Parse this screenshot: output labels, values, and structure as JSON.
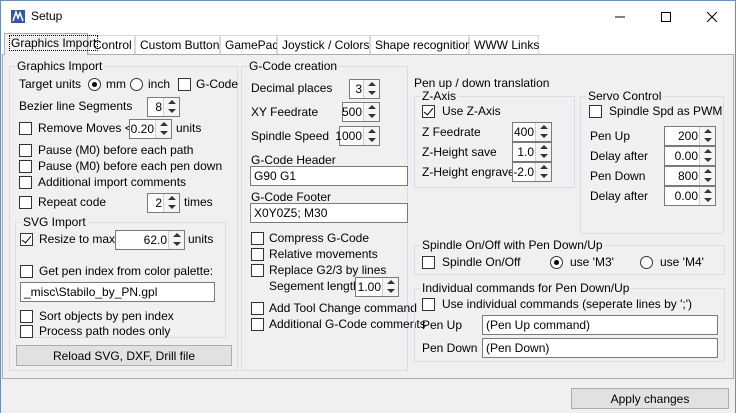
{
  "window": {
    "title": "Setup",
    "icon": "app-icon"
  },
  "tabs": [
    "Graphics Import",
    "Control",
    "Custom Buttons",
    "GamePad",
    "Joystick / Colors",
    "Shape recognition",
    "WWW Links"
  ],
  "gi": {
    "title": "Graphics Import",
    "target_units": "Target units",
    "mm": "mm",
    "inch": "inch",
    "gcode": "G-Code",
    "bezier": "Bezier line Segments",
    "bezier_val": "8",
    "remove_moves": "Remove Moves <",
    "remove_val": "0.20",
    "units": "units",
    "pause_path": "Pause (M0) before each path",
    "pause_pen": "Pause (M0) before each pen down",
    "add_comments": "Additional import comments",
    "repeat": "Repeat code",
    "repeat_val": "2",
    "times": "times",
    "svg": {
      "title": "SVG Import",
      "resize": "Resize to max.",
      "resize_val": "62.0",
      "units": "units",
      "pen_index": "Get pen index from color palette:",
      "palette": "_misc\\Stabilo_by_PN.gpl",
      "sort": "Sort objects by pen index",
      "process": "Process path nodes only"
    },
    "reload": "Reload SVG, DXF, Drill file"
  },
  "gc": {
    "title": "G-Code creation",
    "decimal": "Decimal places",
    "decimal_val": "3",
    "xy": "XY Feedrate",
    "xy_val": "500",
    "spindle": "Spindle Speed",
    "spindle_val": "1000",
    "header": "G-Code Header",
    "header_val": "G90 G1",
    "footer": "G-Code Footer",
    "footer_val": "X0Y0Z5; M30",
    "compress": "Compress G-Code",
    "relative": "Relative movements",
    "replace": "Replace G2/3 by lines",
    "segment": "Segement length",
    "segment_val": "1.00",
    "toolchange": "Add Tool Change command",
    "additional": "Additional G-Code comments"
  },
  "pen": {
    "title": "Pen up / down translation",
    "z": {
      "title": "Z-Axis",
      "use": "Use Z-Axis",
      "feed": "Z Feedrate",
      "feed_val": "400",
      "save": "Z-Height save",
      "save_val": "1.0",
      "engrave": "Z-Height engrave",
      "engrave_val": "-2.0"
    },
    "servo": {
      "title": "Servo Control",
      "pwm": "Spindle Spd as PWM",
      "up": "Pen Up",
      "up_val": "200",
      "d1": "Delay after",
      "d1_val": "0.00",
      "down": "Pen Down",
      "down_val": "800",
      "d2": "Delay after",
      "d2_val": "0.00"
    }
  },
  "spin": {
    "title": "Spindle On/Off with Pen Down/Up",
    "onoff": "Spindle On/Off",
    "m3": "use 'M3'",
    "m4": "use 'M4'"
  },
  "ind": {
    "title": "Individual commands for Pen Down/Up",
    "use": "Use individual commands (seperate lines by ';')",
    "up": "Pen Up",
    "up_val": "(Pen Up command)",
    "down": "Pen Down",
    "down_val": "(Pen Down)"
  },
  "apply": "Apply changes"
}
